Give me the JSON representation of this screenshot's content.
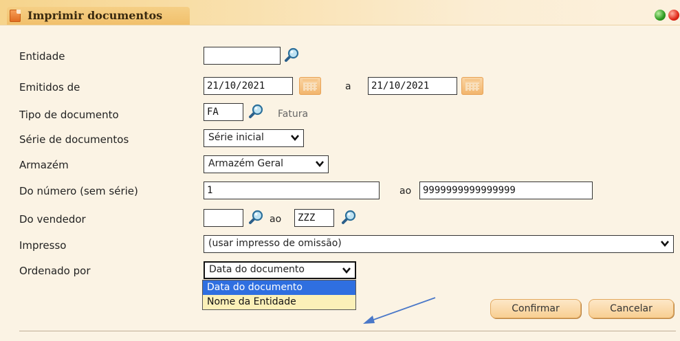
{
  "window": {
    "title": "Imprimir documentos",
    "icons": {
      "app": "document-icon",
      "minimize": "green-dot-icon",
      "close": "red-dot-icon"
    }
  },
  "form": {
    "entidade": {
      "label": "Entidade",
      "value": ""
    },
    "emitidos": {
      "label": "Emitidos de",
      "from": "21/10/2021",
      "separator": "a",
      "to": "21/10/2021"
    },
    "tipo_documento": {
      "label": "Tipo de documento",
      "value": "FA",
      "description": "Fatura"
    },
    "serie_documentos": {
      "label": "Série de documentos",
      "selected": "Série inicial"
    },
    "armazem": {
      "label": "Armazém",
      "selected": "Armazém Geral"
    },
    "numero": {
      "label": "Do número (sem série)",
      "from": "1",
      "separator": "ao",
      "to": "9999999999999999"
    },
    "vendedor": {
      "label": "Do vendedor",
      "from": "",
      "separator": "ao",
      "to": "ZZZ"
    },
    "impresso": {
      "label": "Impresso",
      "selected": "(usar impresso de omissão)"
    },
    "ordenado_por": {
      "label": "Ordenado por",
      "selected": "Data do documento",
      "options": [
        "Data do documento",
        "Nome da Entidade"
      ]
    }
  },
  "buttons": {
    "confirm": "Confirmar",
    "cancel": "Cancelar"
  },
  "colors": {
    "background": "#fbf3e4",
    "titlebar": "#f6d48c",
    "dropdown_bg": "#fbf0b8",
    "selection": "#2f6fe0",
    "button": "#f8cf92",
    "annotation_arrow": "#4a78c8"
  }
}
